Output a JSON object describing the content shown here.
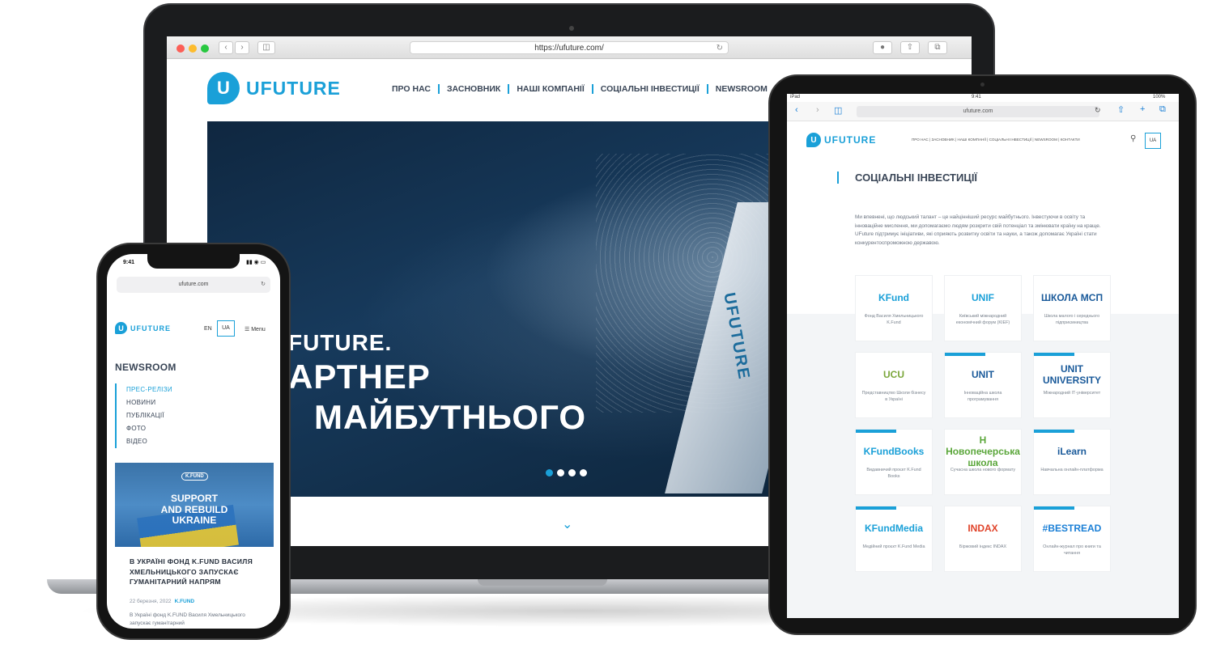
{
  "laptop": {
    "url": "https://ufuture.com/",
    "logo": {
      "mark": "U",
      "text": "UFUTURE"
    },
    "nav": [
      "ПРО НАС",
      "ЗАСНОВНИК",
      "НАШІ КОМПАНІЇ",
      "СОЦІАЛЬНІ ІНВЕСТИЦІЇ",
      "NEWSROOM"
    ],
    "hero": {
      "line1": "FUTURE.",
      "line2": "АРТНЕР",
      "line3": "МАЙБУТНЬОГО",
      "yacht_label": "UFUTURE",
      "slides_total": 4,
      "slide_active": 1
    },
    "scroll_icon": "chevron-down-icon"
  },
  "tablet": {
    "status": {
      "left": "iPad",
      "time": "9:41",
      "right": "100%"
    },
    "url": "ufuture.com",
    "logo": {
      "mark": "U",
      "text": "UFUTURE"
    },
    "nav": "ПРО НАС | ЗАСНОВНИК | НАШІ КОМПАНІЇ | СОЦІАЛЬНІ ІНВЕСТИЦІЇ | NEWSROOM | КОНТАКТИ",
    "lang": "UA",
    "title": "СОЦІАЛЬНІ ІНВЕСТИЦІЇ",
    "paragraph": "Ми впевнені, що людський талант – це найцінніший ресурс майбутнього. Інвестуючи в освіту та інноваційне мислення, ми допомагаємо людям розкрити свій потенціал та змінювати країну на краще. UFuture підтримує ініціативи, які сприяють розвитку освіти та науки, а також допомагає Україні стати конкурентоспроможною державою.",
    "cards": [
      {
        "brand": "KFund",
        "color": "#1aa0d8",
        "tag": false,
        "desc": "Фонд Василя Хмельницького K.Fund"
      },
      {
        "brand": "UNIF",
        "color": "#1aa0d8",
        "tag": false,
        "desc": "Київський міжнародний економічний форум (KIEF)"
      },
      {
        "brand": "ШКОЛА МСП",
        "color": "#1a5a9a",
        "tag": false,
        "desc": "Школа малого і середнього підприємництва"
      },
      {
        "brand": "UCU",
        "color": "#7aa63a",
        "tag": false,
        "desc": "Представництво Школи бізнесу в Україні"
      },
      {
        "brand": "UNIT",
        "color": "#1a5a9a",
        "tag": true,
        "desc": "Інноваційна школа програмування"
      },
      {
        "brand": "UNIT UNIVERSITY",
        "color": "#1a5a9a",
        "tag": true,
        "desc": "Міжнародний ІТ-університет"
      },
      {
        "brand": "KFundBooks",
        "color": "#1aa0d8",
        "tag": true,
        "desc": "Видавничий проєкт K.Fund Books"
      },
      {
        "brand": "H Новопечерська школа",
        "color": "#5aa63a",
        "tag": false,
        "desc": "Сучасна школа нового формату"
      },
      {
        "brand": "iLearn",
        "color": "#1a5a9a",
        "tag": true,
        "desc": "Навчальна онлайн-платформа"
      },
      {
        "brand": "KFundMedia",
        "color": "#1aa0d8",
        "tag": true,
        "desc": "Медійний проєкт K.Fund Media"
      },
      {
        "brand": "INDAX",
        "color": "#e0432a",
        "tag": false,
        "desc": "Біржовий індекс INDAX"
      },
      {
        "brand": "#BESTREAD",
        "color": "#1a7fd6",
        "tag": true,
        "desc": "Онлайн-журнал про книги та читання"
      }
    ]
  },
  "phone": {
    "time": "9:41",
    "url": "ufuture.com",
    "logo": {
      "mark": "U",
      "text": "UFUTURE"
    },
    "lang_en": "EN",
    "lang_ua": "UA",
    "menu": "☰ Menu",
    "section": "NEWSROOM",
    "subnav": [
      "ПРЕС-РЕЛІЗИ",
      "НОВИНИ",
      "ПУБЛІКАЦІЇ",
      "ФОТО",
      "ВІДЕО"
    ],
    "image_badge": "K.FUND",
    "image_line1": "SUPPORT",
    "image_line2": "AND REBUILD",
    "image_line3": "UKRAINE",
    "headline": "В УКРАЇНІ ФОНД K.FUND ВАСИЛЯ ХМЕЛЬНИЦЬКОГО ЗАПУСКАЄ ГУМАНІТАРНИЙ НАПРЯМ",
    "date": "22 березня, 2022",
    "date_tag": "K.FUND",
    "excerpt": "В Україні фонд K.FUND Василя Хмельницького запускає гуманітарний"
  },
  "colors": {
    "accent": "#1aa0d8",
    "heading": "#3a4657",
    "hero_dark": "#0f2740"
  }
}
